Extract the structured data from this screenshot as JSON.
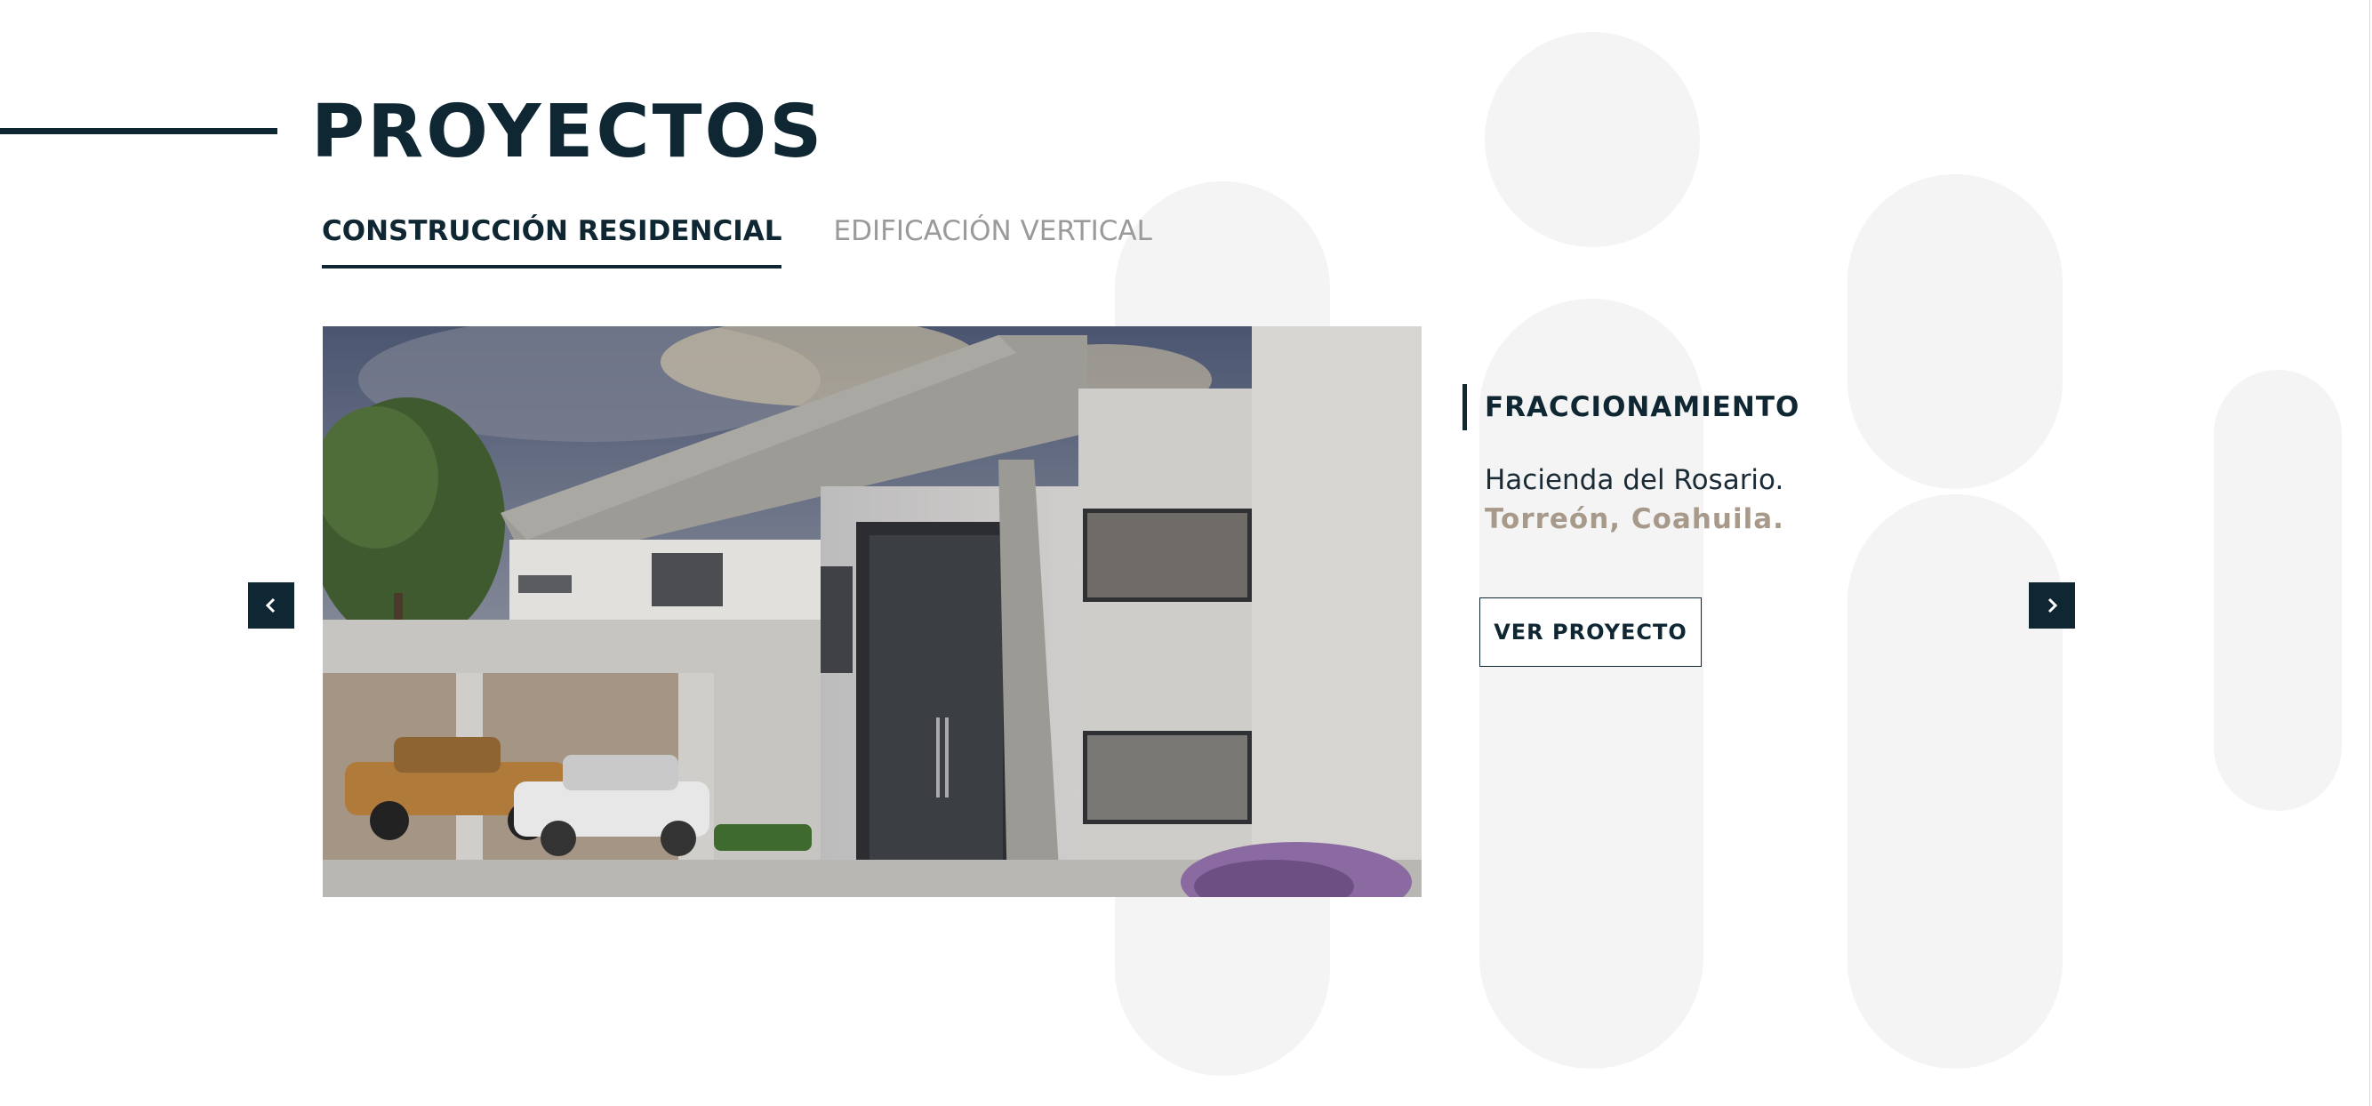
{
  "header": {
    "title": "PROYECTOS"
  },
  "tabs": [
    {
      "label": "CONSTRUCCIÓN RESIDENCIAL",
      "active": true
    },
    {
      "label": "EDIFICACIÓN VERTICAL",
      "active": false
    }
  ],
  "project": {
    "image_alt": "Render de residencia moderna con cochera",
    "category": "FRACCIONAMIENTO",
    "name": "Hacienda del Rosario.",
    "location": "Torreón, Coahuila.",
    "cta_label": "VER PROYECTO"
  },
  "carousel": {
    "prev_icon": "chevron-left-icon",
    "next_icon": "chevron-right-icon"
  },
  "colors": {
    "primary": "#0f2633",
    "accent_location": "#a89a8a",
    "inactive_tab": "#9a9a9a",
    "decor": "#f4f4f4"
  }
}
